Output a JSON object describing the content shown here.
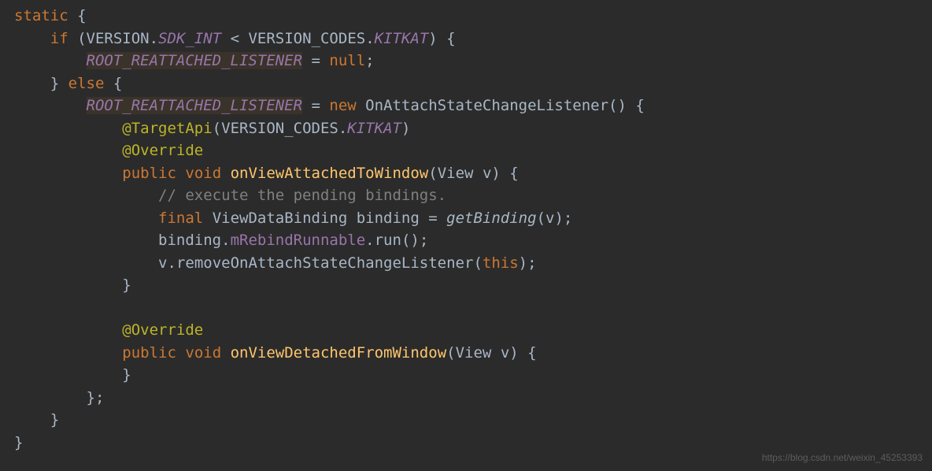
{
  "code": {
    "l1": {
      "static": "static"
    },
    "l2": {
      "if": "if",
      "version": "VERSION",
      "dot1": ".",
      "sdkint": "SDK_INT",
      "lt": " < ",
      "vcodes": "VERSION_CODES",
      "dot2": ".",
      "kitkat": "KITKAT"
    },
    "l3": {
      "root": "ROOT_REATTACHED_LISTENER",
      "eq": " = ",
      "null": "null"
    },
    "l4": {
      "else": "else"
    },
    "l5": {
      "root": "ROOT_REATTACHED_LISTENER",
      "eq": " = ",
      "new": "new",
      "cls": "OnAttachStateChangeListener"
    },
    "l6": {
      "ann": "@TargetApi",
      "vcodes": "VERSION_CODES",
      "dot": ".",
      "kitkat": "KITKAT"
    },
    "l7": {
      "ann": "@Override"
    },
    "l8": {
      "pub": "public",
      "void": "void",
      "name": "onViewAttachedToWindow",
      "ptype": "View",
      "pname": "v"
    },
    "l9": {
      "cmt": "// execute the pending bindings."
    },
    "l10": {
      "final": "final",
      "type": "ViewDataBinding",
      "var": "binding",
      "eq": " = ",
      "call": "getBinding",
      "arg": "v"
    },
    "l11": {
      "obj": "binding",
      "dot1": ".",
      "field": "mRebindRunnable",
      "dot2": ".",
      "run": "run"
    },
    "l12": {
      "obj": "v",
      "dot": ".",
      "call": "removeOnAttachStateChangeListener",
      "this": "this"
    },
    "l15": {
      "ann": "@Override"
    },
    "l16": {
      "pub": "public",
      "void": "void",
      "name": "onViewDetachedFromWindow",
      "ptype": "View",
      "pname": "v"
    }
  },
  "watermark": "https://blog.csdn.net/weixin_45253393"
}
